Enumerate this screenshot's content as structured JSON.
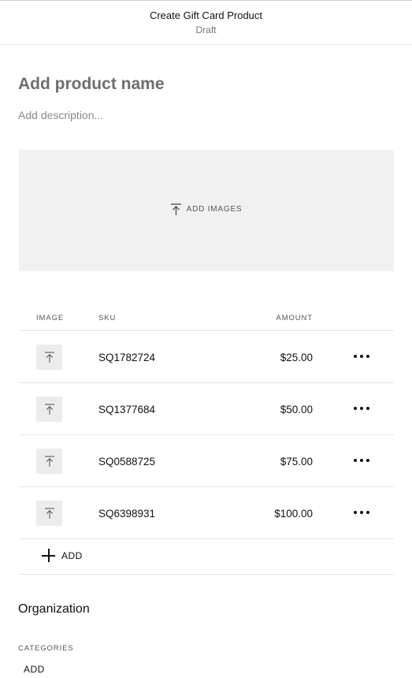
{
  "header": {
    "title": "Create Gift Card Product",
    "status": "Draft"
  },
  "product": {
    "name_placeholder": "Add product name",
    "name_value": "",
    "description_placeholder": "Add description...",
    "description_value": ""
  },
  "images": {
    "add_label": "ADD IMAGES",
    "icon": "upload-icon"
  },
  "variations": {
    "columns": {
      "image": "IMAGE",
      "sku": "SKU",
      "amount": "AMOUNT"
    },
    "rows": [
      {
        "sku": "SQ1782724",
        "amount": "$25.00"
      },
      {
        "sku": "SQ1377684",
        "amount": "$50.00"
      },
      {
        "sku": "SQ0588725",
        "amount": "$75.00"
      },
      {
        "sku": "SQ6398931",
        "amount": "$100.00"
      }
    ],
    "add_label": "ADD"
  },
  "organization": {
    "heading": "Organization",
    "categories_label": "CATEGORIES",
    "categories_add_label": "ADD"
  }
}
